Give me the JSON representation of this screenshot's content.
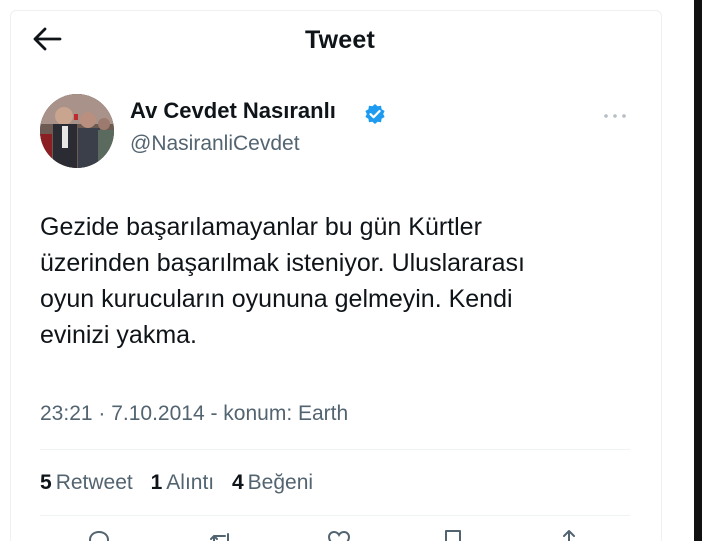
{
  "header": {
    "title": "Tweet",
    "back_icon": "arrow-left-icon"
  },
  "author": {
    "display_name": "Av Cevdet Nasıranlı",
    "handle": "@NasiranliCevdet",
    "verified_icon": "verified-badge-icon",
    "verified_color": "#1d9bf0",
    "more_icon": "more-horizontal-icon"
  },
  "tweet": {
    "lines": [
      "Gezide başarılamayanlar bu gün Kürtler",
      "üzerinden başarılmak isteniyor. Uluslararası",
      "oyun kurucuların oyununa gelmeyin. Kendi",
      "evinizi yakma."
    ],
    "meta": "23:21 · 7.10.2014 - konum: Earth"
  },
  "stats": [
    {
      "count": "5",
      "label": "Retweet"
    },
    {
      "count": "1",
      "label": "Alıntı"
    },
    {
      "count": "4",
      "label": "Beğeni"
    }
  ],
  "actions": [
    "reply-icon",
    "retweet-icon",
    "like-icon",
    "bookmark-icon",
    "share-icon"
  ],
  "colors": {
    "text": "#0f1419",
    "secondary_text": "#536471",
    "divider": "#eff3f4",
    "accent": "#1d9bf0"
  }
}
